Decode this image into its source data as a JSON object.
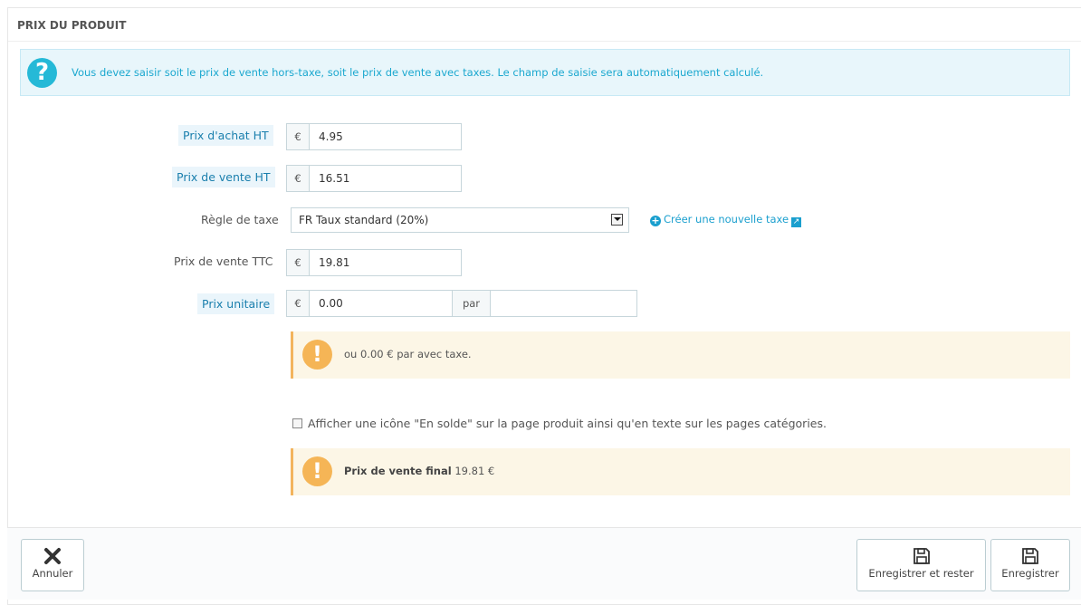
{
  "panel": {
    "title": "PRIX DU PRODUIT"
  },
  "info_alert": {
    "icon": "question-icon",
    "text": "Vous devez saisir soit le prix de vente hors-taxe, soit le prix de vente avec taxes. Le champ de saisie sera automatiquement calculé."
  },
  "fields": {
    "wholesale": {
      "label": "Prix d'achat HT",
      "currency": "€",
      "value": "4.95"
    },
    "price_excl": {
      "label": "Prix de vente HT",
      "currency": "€",
      "value": "16.51"
    },
    "tax_rule": {
      "label": "Règle de taxe",
      "selected": "FR Taux standard (20%)"
    },
    "create_tax_link": "Créer une nouvelle taxe",
    "price_incl": {
      "label": "Prix de vente TTC",
      "currency": "€",
      "value": "19.81"
    },
    "unit_price": {
      "label": "Prix unitaire",
      "currency": "€",
      "value": "0.00",
      "per_label": "par",
      "unity": ""
    }
  },
  "unit_price_alert": {
    "text": "ou 0.00 € par avec taxe."
  },
  "on_sale": {
    "checked": false,
    "label": "Afficher une icône \"En solde\" sur la page produit ainsi qu'en texte sur les pages catégories."
  },
  "final_price_alert": {
    "bold": "Prix de vente final",
    "value": " 19.81 €"
  },
  "footer": {
    "cancel": "Annuler",
    "save_stay": "Enregistrer et rester",
    "save": "Enregistrer"
  },
  "colors": {
    "accent": "#25b9d7",
    "warning": "#f5b556"
  }
}
